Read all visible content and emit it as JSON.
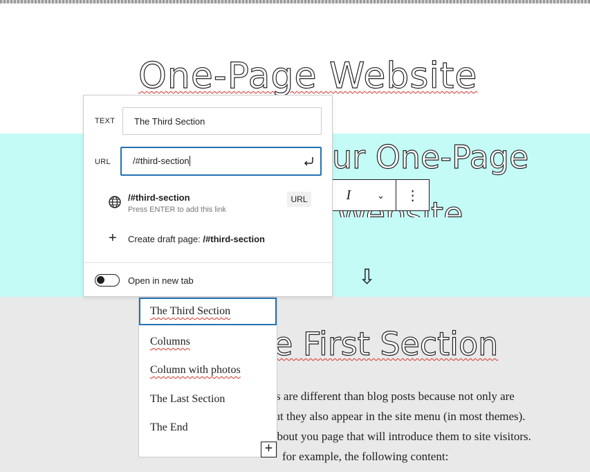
{
  "page": {
    "site_title": "One-Page Website",
    "section_heading_partial": "ur One-Page",
    "section_heading_line2_partial": "Website",
    "arrow_glyph": "⇩",
    "first_section_heading_partial": "e First Section",
    "paragraph_lines": [
      "ges are different than blog posts because not only are",
      "but they also appear in the site menu (in most themes).",
      "about you page that will introduce them to site visitors.",
      "for example, the following content:"
    ]
  },
  "toolbar": {
    "italic_label": "I",
    "chevron_glyph": "⌄",
    "more_glyph": "⋮"
  },
  "link_popover": {
    "text_label": "TEXT",
    "text_value": "The Third Section",
    "url_label": "URL",
    "url_value": "/#third-section",
    "suggestion": {
      "title": "/#third-section",
      "hint": "Press ENTER to add this link",
      "badge": "URL"
    },
    "create_draft": {
      "prefix": "Create draft page: ",
      "value": "/#third-section"
    },
    "open_new_tab_label": "Open in new tab",
    "open_new_tab_enabled": false
  },
  "anchor_menu": {
    "items": [
      "The Third Section",
      "Columns",
      "Column with photos",
      "The Last Section",
      "The End"
    ],
    "selected_index": 0
  },
  "inserter": {
    "glyph": "+"
  },
  "colors": {
    "cyan_band": "#c4fbf7",
    "gray_band": "#e9e9e9",
    "accent": "#2271b1"
  }
}
